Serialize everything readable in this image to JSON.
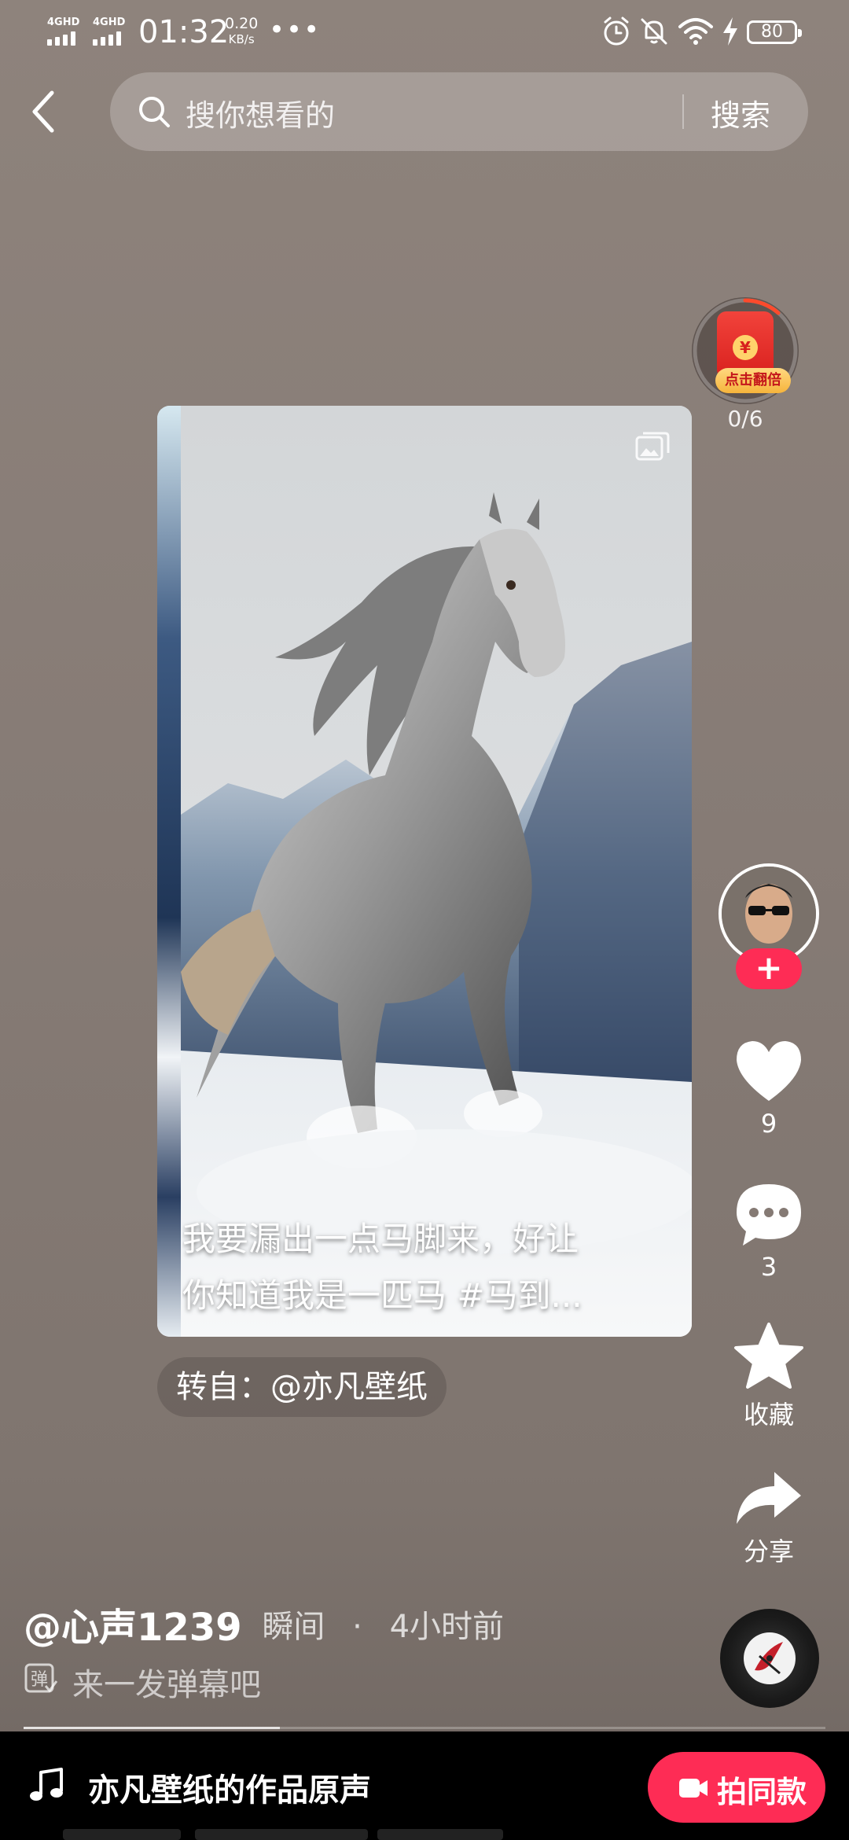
{
  "status_bar": {
    "sim1": "4G",
    "sim1_sup": "HD",
    "sim2": "4G",
    "sim2_sup": "HD",
    "time": "01:32",
    "net_speed_value": "0.20",
    "net_speed_unit": "KB/s",
    "more": "•••",
    "battery": "80",
    "icons": [
      "alarm-icon",
      "mute-icon",
      "wifi-icon",
      "charging-icon"
    ]
  },
  "search": {
    "placeholder": "搜你想看的",
    "button": "搜索"
  },
  "red_packet": {
    "label": "点击翻倍",
    "coin": "¥",
    "progress": "0/6"
  },
  "post": {
    "caption_line1": "我要漏出一点马脚来，好让",
    "caption_line2": "你知道我是一匹马 #马到...",
    "repost": "转自：@亦凡壁纸"
  },
  "actions": {
    "follow": "+",
    "likes": "9",
    "comments": "3",
    "favorite": "收藏",
    "share": "分享"
  },
  "author": {
    "name": "@心声1239",
    "type": "瞬间",
    "time": "4小时前",
    "separator": "·"
  },
  "danmu": {
    "icon_text": "弹",
    "placeholder": "来一发弹幕吧"
  },
  "progress": 0.32,
  "music": {
    "title": "亦凡壁纸的作品原声",
    "same_button": "拍同款"
  },
  "colors": {
    "accent": "#fe2c55",
    "background": "#857a74"
  }
}
